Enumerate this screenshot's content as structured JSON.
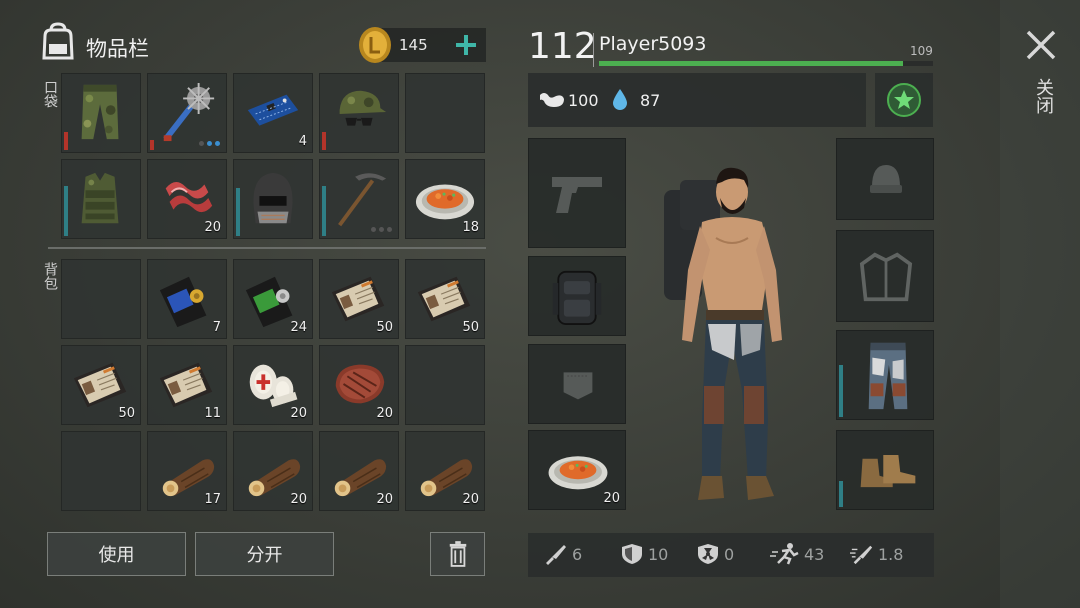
{
  "inventory": {
    "title": "物品栏",
    "coins": "145",
    "plus_label": "+",
    "pockets_label": "口袋",
    "backpack_label": "背包",
    "pocket_items": [
      {
        "name": "camo-pants",
        "count": ""
      },
      {
        "name": "spiked-mace",
        "count": ""
      },
      {
        "name": "circuit-board",
        "count": "4"
      },
      {
        "name": "camo-cap-sunglasses",
        "count": ""
      },
      {
        "name": "empty",
        "count": ""
      },
      {
        "name": "camo-vest",
        "count": ""
      },
      {
        "name": "raw-bacon",
        "count": "20"
      },
      {
        "name": "welding-helmet",
        "count": ""
      },
      {
        "name": "pickaxe",
        "count": ""
      },
      {
        "name": "stew-plate",
        "count": "18"
      }
    ],
    "backpack_items": [
      {
        "name": "empty",
        "count": ""
      },
      {
        "name": "police-badge-blue",
        "count": "7"
      },
      {
        "name": "police-badge-green",
        "count": "24"
      },
      {
        "name": "id-card",
        "count": "50"
      },
      {
        "name": "id-card",
        "count": "50"
      },
      {
        "name": "id-card",
        "count": "50"
      },
      {
        "name": "id-card",
        "count": "11"
      },
      {
        "name": "bandage",
        "count": "20"
      },
      {
        "name": "steak",
        "count": "20"
      },
      {
        "name": "empty",
        "count": ""
      },
      {
        "name": "empty",
        "count": ""
      },
      {
        "name": "log",
        "count": "17"
      },
      {
        "name": "log",
        "count": "20"
      },
      {
        "name": "log",
        "count": "20"
      },
      {
        "name": "log",
        "count": "20"
      }
    ],
    "use_button": "使用",
    "split_button": "分开"
  },
  "player": {
    "level": "112",
    "name": "Player5093",
    "xp_value": "109",
    "xp_fraction": 0.91,
    "hunger": "100",
    "thirst": "87",
    "food_slot_count": "20"
  },
  "stats": {
    "attack": "6",
    "defense": "10",
    "radiation": "0",
    "speed": "43",
    "attack_speed": "1.8"
  },
  "close_label": "关闭",
  "colors": {
    "xp_bar": "#4caf50",
    "accent_teal": "#3fb6a8",
    "durability_red": "#b3342a",
    "durability_teal": "#2f7f86"
  }
}
